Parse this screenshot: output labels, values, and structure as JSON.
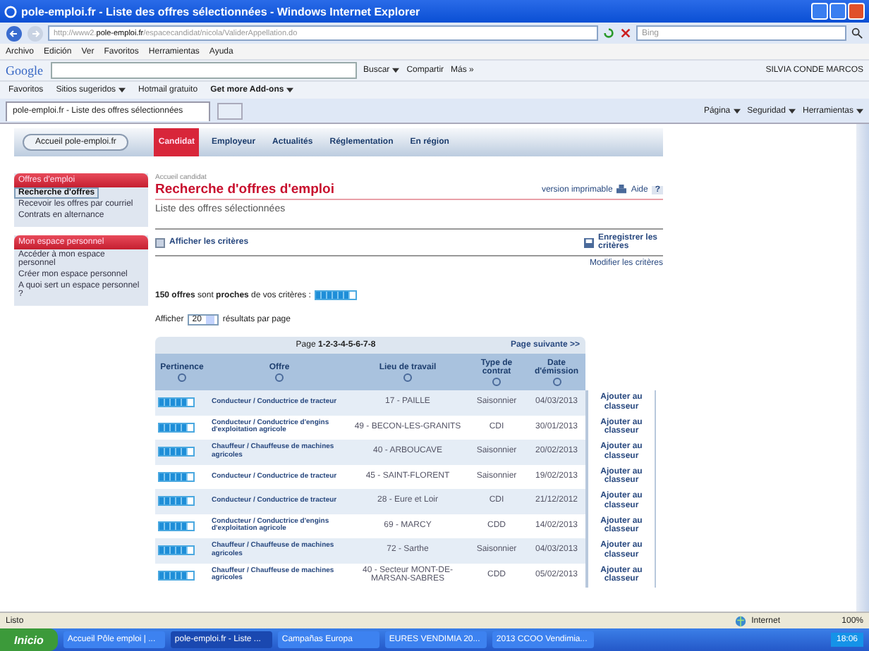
{
  "window": {
    "title": "pole-emploi.fr - Liste des offres sélectionnées - Windows Internet Explorer"
  },
  "address_bar": {
    "url_prefix": "http://www2.",
    "url_domain": "pole-emploi.fr",
    "url_path": "/espacecandidat/nicola/ValiderAppellation.do",
    "search_placeholder": "Bing"
  },
  "menu": [
    "Archivo",
    "Edición",
    "Ver",
    "Favoritos",
    "Herramientas",
    "Ayuda"
  ],
  "google_toolbar": {
    "logo": "Google",
    "buttons": [
      {
        "label": "Buscar",
        "dropdown": true
      },
      {
        "label": "Compartir",
        "dropdown": false
      },
      {
        "label": "Más »",
        "dropdown": false
      }
    ],
    "user": "SILVIA CONDE MARCOS"
  },
  "favorites_bar": {
    "label": "Favoritos",
    "items": [
      {
        "label": "Sitios sugeridos",
        "dropdown": true,
        "bold": false
      },
      {
        "label": "Hotmail gratuito",
        "dropdown": false,
        "bold": false
      },
      {
        "label": "Get more Add-ons",
        "dropdown": true,
        "bold": true
      }
    ]
  },
  "tab": {
    "title": "pole-emploi.fr - Liste des offres sélectionnées"
  },
  "command_bar": [
    "Página",
    "Seguridad",
    "Herramientas"
  ],
  "site_nav": {
    "home": "Accueil pole-emploi.fr",
    "tabs": [
      {
        "label": "Candidat",
        "selected": true
      },
      {
        "label": "Employeur",
        "selected": false
      },
      {
        "label": "Actualités",
        "selected": false
      },
      {
        "label": "Réglementation",
        "selected": false
      },
      {
        "label": "En région",
        "selected": false
      }
    ]
  },
  "sidebar": [
    {
      "title": "Offres d'emploi",
      "items": [
        {
          "label": "Recherche d'offres",
          "selected": true
        },
        {
          "label": "Recevoir les offres par courriel",
          "selected": false
        },
        {
          "label": "Contrats en alternance",
          "selected": false
        }
      ]
    },
    {
      "title": "Mon espace personnel",
      "items": [
        {
          "label": "Accéder à mon espace personnel",
          "selected": false
        },
        {
          "label": "Créer mon espace personnel",
          "selected": false
        },
        {
          "label": "A quoi sert un espace personnel ?",
          "selected": false
        }
      ]
    }
  ],
  "main": {
    "breadcrumb": "Accueil candidat",
    "heading": "Recherche d'offres d'emploi",
    "print": "version imprimable",
    "help": "Aide",
    "help_icon": "?",
    "subtitle": "Liste des offres sélectionnées",
    "show_criteria": "Afficher les critères",
    "save_criteria": "Enregistrer les critères",
    "modify_criteria": "Modifier les critères",
    "summary": {
      "text": "**150 offres** sont **proches** de vos critères :",
      "level": 0.85
    },
    "show_label": "Afficher",
    "per_page": "20",
    "per_page_label": "résultats par page"
  },
  "pagination": {
    "label": "Page",
    "pages": "1-2-3-4-5-6-7-8",
    "next": "Page suivante >>"
  },
  "table": {
    "columns": [
      "Pertinence",
      "Offre",
      "Lieu de travail",
      "Type de contrat",
      "Date d'émission"
    ],
    "rows": [
      {
        "level": 0.85,
        "offer": "Conducteur / Conductrice de tracteur",
        "place": "17 - PAILLE",
        "contract": "Saisonnier",
        "date": "04/03/2013",
        "action": "Ajouter au classeur"
      },
      {
        "level": 0.85,
        "offer": "Conducteur / Conductrice d'engins d'exploitation agricole",
        "place": "49 - BECON-LES-GRANITS",
        "contract": "CDI",
        "date": "30/01/2013",
        "action": "Ajouter au classeur"
      },
      {
        "level": 0.85,
        "offer": "Chauffeur / Chauffeuse de machines agricoles",
        "place": "40 - ARBOUCAVE",
        "contract": "Saisonnier",
        "date": "20/02/2013",
        "action": "Ajouter au classeur"
      },
      {
        "level": 0.85,
        "offer": "Conducteur / Conductrice de tracteur",
        "place": "45 - SAINT-FLORENT",
        "contract": "Saisonnier",
        "date": "19/02/2013",
        "action": "Ajouter au classeur"
      },
      {
        "level": 0.85,
        "offer": "Conducteur / Conductrice de tracteur",
        "place": "28 - Eure et Loir",
        "contract": "CDI",
        "date": "21/12/2012",
        "action": "Ajouter au classeur"
      },
      {
        "level": 0.85,
        "offer": "Conducteur / Conductrice d'engins d'exploitation agricole",
        "place": "69 - MARCY",
        "contract": "CDD",
        "date": "14/02/2013",
        "action": "Ajouter au classeur"
      },
      {
        "level": 0.85,
        "offer": "Chauffeur / Chauffeuse de machines agricoles",
        "place": "72 - Sarthe",
        "contract": "Saisonnier",
        "date": "04/03/2013",
        "action": "Ajouter au classeur"
      },
      {
        "level": 0.85,
        "offer": "Chauffeur / Chauffeuse de machines agricoles",
        "place": "40 - Secteur MONT-DE-MARSAN-SABRES",
        "contract": "CDD",
        "date": "05/02/2013",
        "action": "Ajouter au classeur"
      }
    ]
  },
  "status_bar": {
    "text": "Listo",
    "zone": "Internet",
    "zoom": "100%"
  },
  "taskbar": {
    "start": "Inicio",
    "tasks": [
      {
        "label": "Accueil Pôle emploi | ...",
        "selected": false
      },
      {
        "label": "pole-emploi.fr - Liste ...",
        "selected": true
      },
      {
        "label": "Campañas Europa",
        "selected": false
      },
      {
        "label": "EURES VENDIMIA 20...",
        "selected": false
      },
      {
        "label": "2013 CCOO Vendimia...",
        "selected": false
      }
    ],
    "clock": "18:06"
  }
}
